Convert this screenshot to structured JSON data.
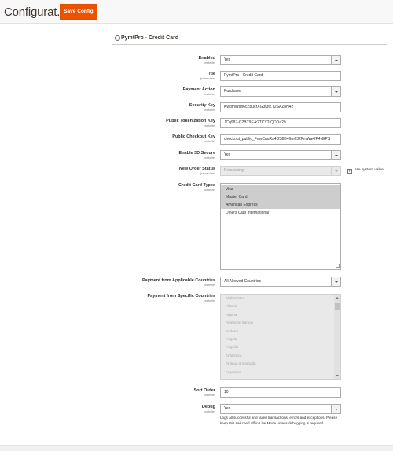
{
  "header": {
    "title": "Configurat...",
    "save_label": "Save Config"
  },
  "section": {
    "title": "PymtPro - Credit Card"
  },
  "fields": {
    "enabled": {
      "label": "Enabled",
      "scope": "[website]",
      "value": "Yes"
    },
    "title": {
      "label": "Title",
      "scope": "[store view]",
      "value": "PymtPro - Credit Card"
    },
    "payment_action": {
      "label": "Payment Action",
      "scope": "[website]",
      "value": "Purchase"
    },
    "security_key": {
      "label": "Security Key",
      "scope": "[website]",
      "value": "Kwqmvzjm6cZpucrXG3f3tZT2SAZnH4z"
    },
    "public_tokenization_key": {
      "label": "Public Tokenization Key",
      "scope": "[website]",
      "value": "JCq987-C2BT9E-k2TCY2-QDDa29"
    },
    "public_checkout_key": {
      "label": "Public Checkout Key",
      "scope": "[website]",
      "value": "checkout_public_FmvCnuRa4f238B46m632FmWa4fP4vEPS"
    },
    "enable_3d_secure": {
      "label": "Enable 3D Secure",
      "scope": "[website]",
      "value": "Yes"
    },
    "new_order_status": {
      "label": "New Order Status",
      "scope": "[store view]",
      "value": "Processing",
      "use_system_label": "Use system value",
      "use_system_checked": "✓"
    },
    "credit_card_types": {
      "label": "Credit Card Types",
      "scope": "[website]",
      "options": [
        "Visa",
        "Master Card",
        "American Express",
        "Diners Club International"
      ]
    },
    "applicable_countries": {
      "label": "Payment from Applicable Countries",
      "scope": "[website]",
      "value": "All Allowed Countries"
    },
    "specific_countries": {
      "label": "Payment from Specific Countries",
      "scope": "[website]",
      "options": [
        "Afghanistan",
        "Albania",
        "Algeria",
        "American Samoa",
        "Andorra",
        "Angola",
        "Anguilla",
        "Antarctica",
        "Antigua & Barbuda",
        "Argentina"
      ]
    },
    "sort_order": {
      "label": "Sort Order",
      "scope": "[website]",
      "value": "10"
    },
    "debug": {
      "label": "Debug",
      "scope": "[website]",
      "value": "Yes",
      "note": "Logs all successful and failed transactions, errors and exceptions. Please keep this switched off in Live Mode unless debugging is required."
    }
  }
}
